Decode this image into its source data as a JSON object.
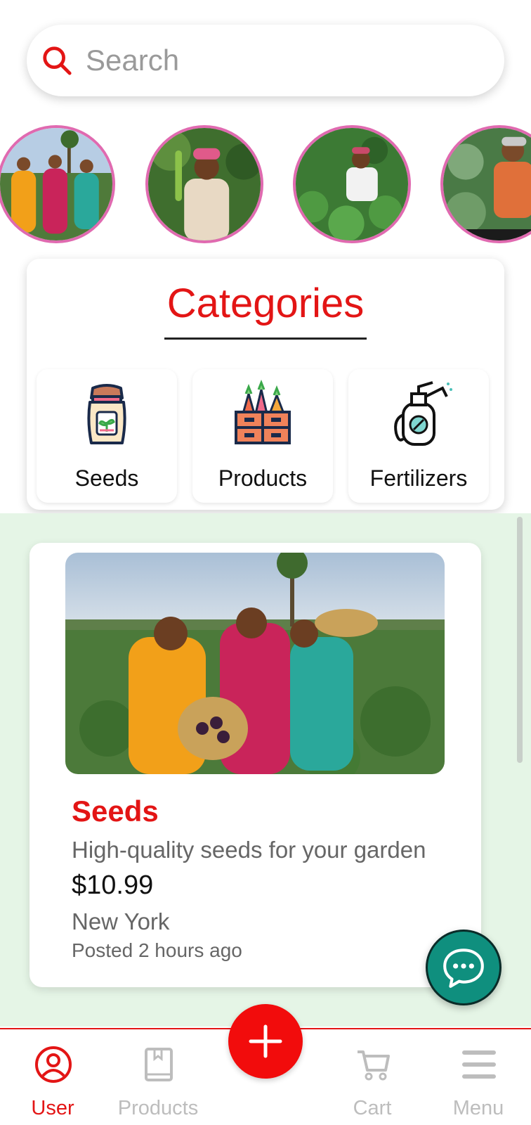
{
  "search": {
    "placeholder": "Search"
  },
  "stories": [
    {
      "name": "story-farmers-women"
    },
    {
      "name": "story-farmer-beans"
    },
    {
      "name": "story-farmer-field"
    },
    {
      "name": "story-farmer-cabbage"
    }
  ],
  "categories": {
    "title": "Categories",
    "items": [
      {
        "label": "Seeds",
        "icon": "seed-bag-icon"
      },
      {
        "label": "Products",
        "icon": "vegetable-crate-icon"
      },
      {
        "label": "Fertilizers",
        "icon": "sprayer-icon"
      }
    ]
  },
  "product": {
    "title": "Seeds",
    "description": "High-quality seeds for your garden",
    "price": "$10.99",
    "location": "New York",
    "posted": "Posted 2 hours ago"
  },
  "chat": {
    "icon": "chat-bubble-icon"
  },
  "nav": {
    "items": [
      {
        "label": "User",
        "icon": "user-icon",
        "active": true
      },
      {
        "label": "Products",
        "icon": "book-icon",
        "active": false
      },
      {
        "label": "Cart",
        "icon": "cart-icon",
        "active": false
      },
      {
        "label": "Menu",
        "icon": "menu-icon",
        "active": false
      }
    ],
    "add_icon": "plus-icon"
  },
  "colors": {
    "accent": "#e31515",
    "story_ring": "#e06ab0",
    "feed_bg": "#e5f5e6",
    "chat_fab": "#0f8f7e",
    "inactive": "#bdbdbd"
  }
}
